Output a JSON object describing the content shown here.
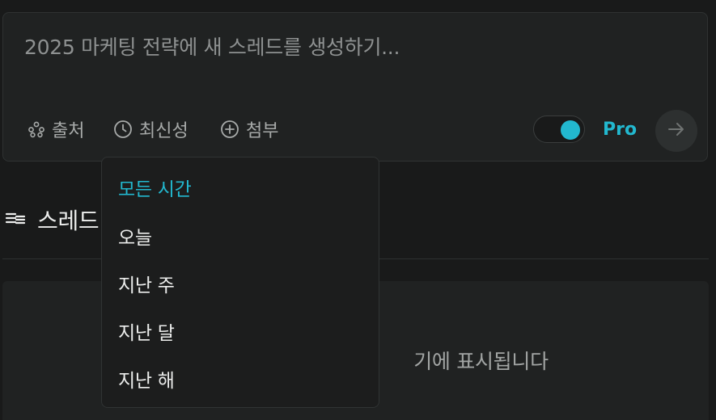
{
  "composer": {
    "placeholder": "2025 마케팅 전략에 새 스레드를 생성하기...",
    "tools": {
      "sources_label": "출처",
      "sources_icon": "sources-icon",
      "recency_label": "최신성",
      "recency_icon": "clock-icon",
      "attach_label": "첨부",
      "attach_icon": "plus-circle-icon"
    },
    "pro_toggle": {
      "label": "Pro",
      "on": true
    },
    "submit_icon": "arrow-right-icon"
  },
  "threads": {
    "title": "스레드",
    "icon": "threads-list-icon",
    "empty_text": "기에 표시됩니다"
  },
  "recency_menu": {
    "selected": "모든 시간",
    "options": [
      "모든 시간",
      "오늘",
      "지난 주",
      "지난 달",
      "지난 해"
    ]
  },
  "colors": {
    "accent": "#22b8cf",
    "background": "#191a1a",
    "surface": "#202222",
    "muted_text": "#a7aaa9"
  }
}
